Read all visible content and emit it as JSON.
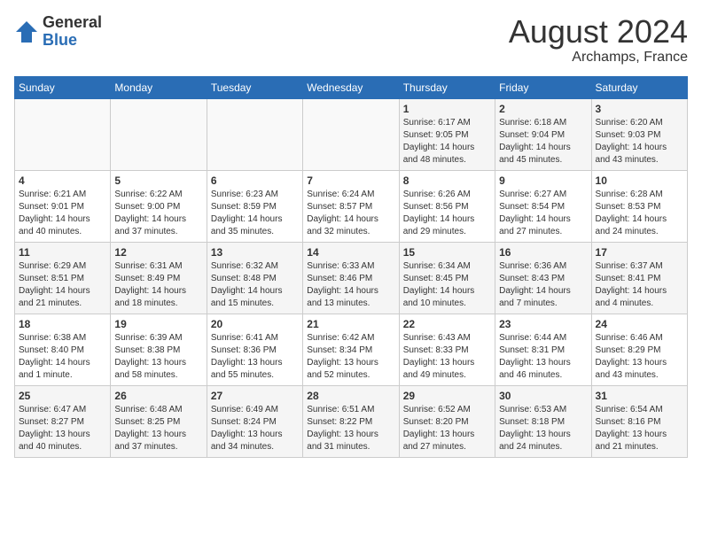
{
  "logo": {
    "general": "General",
    "blue": "Blue"
  },
  "title": {
    "month_year": "August 2024",
    "location": "Archamps, France"
  },
  "days_of_week": [
    "Sunday",
    "Monday",
    "Tuesday",
    "Wednesday",
    "Thursday",
    "Friday",
    "Saturday"
  ],
  "weeks": [
    [
      {
        "day": "",
        "info": ""
      },
      {
        "day": "",
        "info": ""
      },
      {
        "day": "",
        "info": ""
      },
      {
        "day": "",
        "info": ""
      },
      {
        "day": "1",
        "info": "Sunrise: 6:17 AM\nSunset: 9:05 PM\nDaylight: 14 hours\nand 48 minutes."
      },
      {
        "day": "2",
        "info": "Sunrise: 6:18 AM\nSunset: 9:04 PM\nDaylight: 14 hours\nand 45 minutes."
      },
      {
        "day": "3",
        "info": "Sunrise: 6:20 AM\nSunset: 9:03 PM\nDaylight: 14 hours\nand 43 minutes."
      }
    ],
    [
      {
        "day": "4",
        "info": "Sunrise: 6:21 AM\nSunset: 9:01 PM\nDaylight: 14 hours\nand 40 minutes."
      },
      {
        "day": "5",
        "info": "Sunrise: 6:22 AM\nSunset: 9:00 PM\nDaylight: 14 hours\nand 37 minutes."
      },
      {
        "day": "6",
        "info": "Sunrise: 6:23 AM\nSunset: 8:59 PM\nDaylight: 14 hours\nand 35 minutes."
      },
      {
        "day": "7",
        "info": "Sunrise: 6:24 AM\nSunset: 8:57 PM\nDaylight: 14 hours\nand 32 minutes."
      },
      {
        "day": "8",
        "info": "Sunrise: 6:26 AM\nSunset: 8:56 PM\nDaylight: 14 hours\nand 29 minutes."
      },
      {
        "day": "9",
        "info": "Sunrise: 6:27 AM\nSunset: 8:54 PM\nDaylight: 14 hours\nand 27 minutes."
      },
      {
        "day": "10",
        "info": "Sunrise: 6:28 AM\nSunset: 8:53 PM\nDaylight: 14 hours\nand 24 minutes."
      }
    ],
    [
      {
        "day": "11",
        "info": "Sunrise: 6:29 AM\nSunset: 8:51 PM\nDaylight: 14 hours\nand 21 minutes."
      },
      {
        "day": "12",
        "info": "Sunrise: 6:31 AM\nSunset: 8:49 PM\nDaylight: 14 hours\nand 18 minutes."
      },
      {
        "day": "13",
        "info": "Sunrise: 6:32 AM\nSunset: 8:48 PM\nDaylight: 14 hours\nand 15 minutes."
      },
      {
        "day": "14",
        "info": "Sunrise: 6:33 AM\nSunset: 8:46 PM\nDaylight: 14 hours\nand 13 minutes."
      },
      {
        "day": "15",
        "info": "Sunrise: 6:34 AM\nSunset: 8:45 PM\nDaylight: 14 hours\nand 10 minutes."
      },
      {
        "day": "16",
        "info": "Sunrise: 6:36 AM\nSunset: 8:43 PM\nDaylight: 14 hours\nand 7 minutes."
      },
      {
        "day": "17",
        "info": "Sunrise: 6:37 AM\nSunset: 8:41 PM\nDaylight: 14 hours\nand 4 minutes."
      }
    ],
    [
      {
        "day": "18",
        "info": "Sunrise: 6:38 AM\nSunset: 8:40 PM\nDaylight: 14 hours\nand 1 minute."
      },
      {
        "day": "19",
        "info": "Sunrise: 6:39 AM\nSunset: 8:38 PM\nDaylight: 13 hours\nand 58 minutes."
      },
      {
        "day": "20",
        "info": "Sunrise: 6:41 AM\nSunset: 8:36 PM\nDaylight: 13 hours\nand 55 minutes."
      },
      {
        "day": "21",
        "info": "Sunrise: 6:42 AM\nSunset: 8:34 PM\nDaylight: 13 hours\nand 52 minutes."
      },
      {
        "day": "22",
        "info": "Sunrise: 6:43 AM\nSunset: 8:33 PM\nDaylight: 13 hours\nand 49 minutes."
      },
      {
        "day": "23",
        "info": "Sunrise: 6:44 AM\nSunset: 8:31 PM\nDaylight: 13 hours\nand 46 minutes."
      },
      {
        "day": "24",
        "info": "Sunrise: 6:46 AM\nSunset: 8:29 PM\nDaylight: 13 hours\nand 43 minutes."
      }
    ],
    [
      {
        "day": "25",
        "info": "Sunrise: 6:47 AM\nSunset: 8:27 PM\nDaylight: 13 hours\nand 40 minutes."
      },
      {
        "day": "26",
        "info": "Sunrise: 6:48 AM\nSunset: 8:25 PM\nDaylight: 13 hours\nand 37 minutes."
      },
      {
        "day": "27",
        "info": "Sunrise: 6:49 AM\nSunset: 8:24 PM\nDaylight: 13 hours\nand 34 minutes."
      },
      {
        "day": "28",
        "info": "Sunrise: 6:51 AM\nSunset: 8:22 PM\nDaylight: 13 hours\nand 31 minutes."
      },
      {
        "day": "29",
        "info": "Sunrise: 6:52 AM\nSunset: 8:20 PM\nDaylight: 13 hours\nand 27 minutes."
      },
      {
        "day": "30",
        "info": "Sunrise: 6:53 AM\nSunset: 8:18 PM\nDaylight: 13 hours\nand 24 minutes."
      },
      {
        "day": "31",
        "info": "Sunrise: 6:54 AM\nSunset: 8:16 PM\nDaylight: 13 hours\nand 21 minutes."
      }
    ]
  ]
}
